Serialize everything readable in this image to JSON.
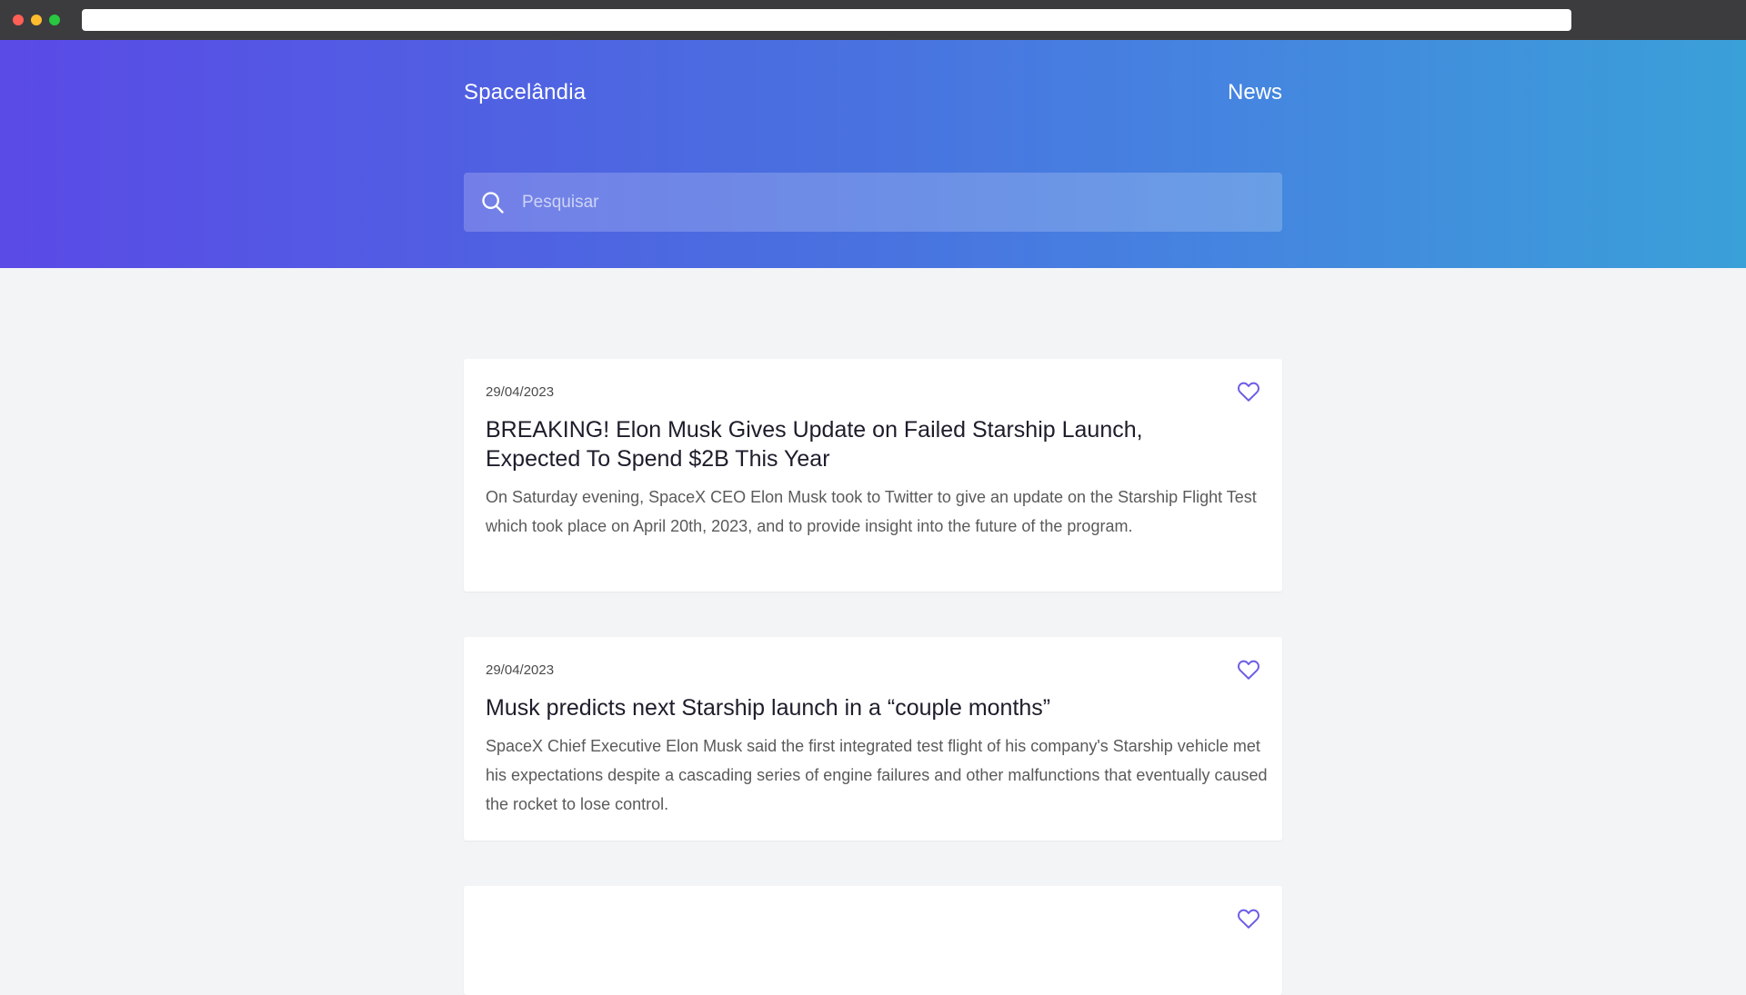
{
  "header": {
    "brand": "Spacelândia",
    "nav_news": "News",
    "search_placeholder": "Pesquisar"
  },
  "articles": [
    {
      "date": "29/04/2023",
      "title": "BREAKING! Elon Musk Gives Update on Failed Starship Launch, Expected To Spend $2B This Year",
      "summary": "On Saturday evening, SpaceX CEO Elon Musk took to Twitter to give an update on the Starship Flight Test which took place on April 20th, 2023, and to provide insight into the future of the program."
    },
    {
      "date": "29/04/2023",
      "title": "Musk predicts next Starship launch in a “couple months”",
      "summary": "SpaceX Chief Executive Elon Musk said the first integrated test flight of his company's Starship vehicle met his expectations despite a cascading series of engine failures and other malfunctions that eventually caused the rocket to lose control."
    }
  ],
  "colors": {
    "accent": "#5a4ae6",
    "heart": "#6b5ce7"
  }
}
